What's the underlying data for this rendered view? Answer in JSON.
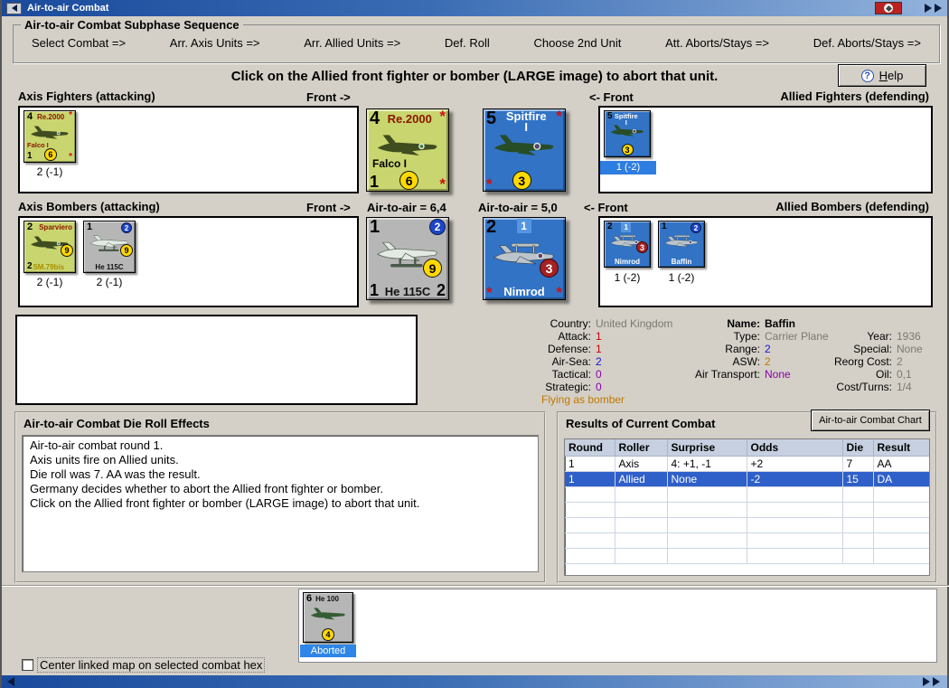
{
  "window": {
    "title": "Air-to-air Combat"
  },
  "sequence": {
    "title": "Air-to-air Combat Subphase Sequence",
    "phases": [
      "Select Combat =>",
      "Arr. Axis Units =>",
      "Arr. Allied Units =>",
      "Def. Roll",
      "Choose 2nd Unit",
      "Att. Aborts/Stays =>",
      "Def. Aborts/Stays =>"
    ]
  },
  "instruction": "Click on the Allied front fighter or bomber  (LARGE image) to abort that unit.",
  "help": {
    "label": "Help"
  },
  "sections": {
    "axis_fighters": "Axis Fighters (attacking)",
    "front_attack": "Front ->",
    "front_defend": "<- Front",
    "allied_fighters": "Allied Fighters (defending)",
    "axis_bombers": "Axis Bombers (attacking)",
    "axis_air": "Air-to-air = 6,4",
    "allied_air": "Air-to-air = 5,0",
    "allied_bombers": "Allied Bombers (defending)"
  },
  "counters": {
    "axis_fighter_small": {
      "tl": "4",
      "name": "Re.2000",
      "star": "*",
      "sub": "Falco I",
      "bl": "1",
      "circle": "6",
      "status": "2 (-1)"
    },
    "axis_fighter_large": {
      "tl": "4",
      "name": "Re.2000",
      "star": "*",
      "sub": "Falco I",
      "bl": "1",
      "circle": "6"
    },
    "allied_fighter_large": {
      "tl": "5",
      "name": "Spitfire",
      "name2": "I",
      "star": "*",
      "circle": "3"
    },
    "allied_fighter_small": {
      "tl": "5",
      "name": "Spitfire",
      "name2": "I",
      "circle": "3",
      "status": "1 (-2)"
    },
    "axis_bomber1_small": {
      "tl": "2",
      "name": "Sparviero",
      "circle": "9",
      "bl": "2",
      "sub": "SM.79bis",
      "status": "2 (-1)"
    },
    "axis_bomber2_small": {
      "tl": "1",
      "blue": "2",
      "circle": "9",
      "name": "He 115C",
      "status": "2 (-1)"
    },
    "axis_bomber_large": {
      "tl": "1",
      "blue": "2",
      "circle": "9",
      "bl": "1",
      "name": "He 115C",
      "br": "2"
    },
    "allied_bomber_large": {
      "tl": "2",
      "marker": "1",
      "red": "3",
      "name": "Nimrod",
      "star": "*"
    },
    "allied_bomber1_small": {
      "tl": "2",
      "marker": "1",
      "red": "3",
      "name": "Nimrod",
      "status": "1 (-2)"
    },
    "allied_bomber2_small": {
      "tl": "1",
      "blue": "2",
      "name": "Baffin",
      "status": "1 (-2)"
    },
    "aborted_unit": {
      "tl": "6",
      "name": "He 100",
      "circle": "4",
      "badge": "Aborted"
    }
  },
  "unit_info": {
    "country_label": "Country:",
    "country": "United Kingdom",
    "name_label": "Name:",
    "name": "Baffin",
    "attack_label": "Attack:",
    "attack": "1",
    "type_label": "Type:",
    "type": "Carrier Plane",
    "year_label": "Year:",
    "year": "1936",
    "defense_label": "Defense:",
    "defense": "1",
    "range_label": "Range:",
    "range": "2",
    "special_label": "Special:",
    "special": "None",
    "air_sea_label": "Air-Sea:",
    "air_sea": "2",
    "asw_label": "ASW:",
    "asw": "2",
    "reorg_label": "Reorg Cost:",
    "reorg": "2",
    "tactical_label": "Tactical:",
    "tactical": "0",
    "air_transport_label": "Air Transport:",
    "air_transport": "None",
    "oil_label": "Oil:",
    "oil": "0,1",
    "strategic_label": "Strategic:",
    "strategic": "0",
    "cost_turns_label": "Cost/Turns:",
    "cost_turns": "1/4",
    "note": "Flying as bomber"
  },
  "effects": {
    "title": "Air-to-air Combat Die Roll Effects",
    "lines": [
      "Air-to-air combat round 1.",
      "Axis units fire on Allied units.",
      "Die roll was 7.  AA was the result.",
      "Germany decides whether to abort the Allied front fighter or bomber.",
      "Click on the Allied front fighter or bomber  (LARGE image) to abort that unit."
    ]
  },
  "results": {
    "title": "Results of Current Combat",
    "chart_button": "Air-to-air Combat Chart",
    "columns": [
      "Round",
      "Roller",
      "Surprise",
      "Odds",
      "Die",
      "Result"
    ],
    "rows": [
      {
        "round": "1",
        "roller": "Axis",
        "surprise": "4: +1, -1",
        "odds": "+2",
        "die": "7",
        "result": "AA",
        "highlight": false
      },
      {
        "round": "1",
        "roller": "Allied",
        "surprise": "None",
        "odds": "-2",
        "die": "15",
        "result": "DA",
        "highlight": true
      }
    ]
  },
  "footer": {
    "checkbox_label": "Center linked map on selected combat hex"
  },
  "colors": {
    "axis_counter": "#c9d56e",
    "allied_counter": "#3273c5",
    "gray_counter": "#b6b6b6",
    "selected_row": "#2f5fc8",
    "aborted_badge": "#2e86e8",
    "titlebar_left": "#1a4a9c",
    "titlebar_right": "#93b3dc"
  }
}
